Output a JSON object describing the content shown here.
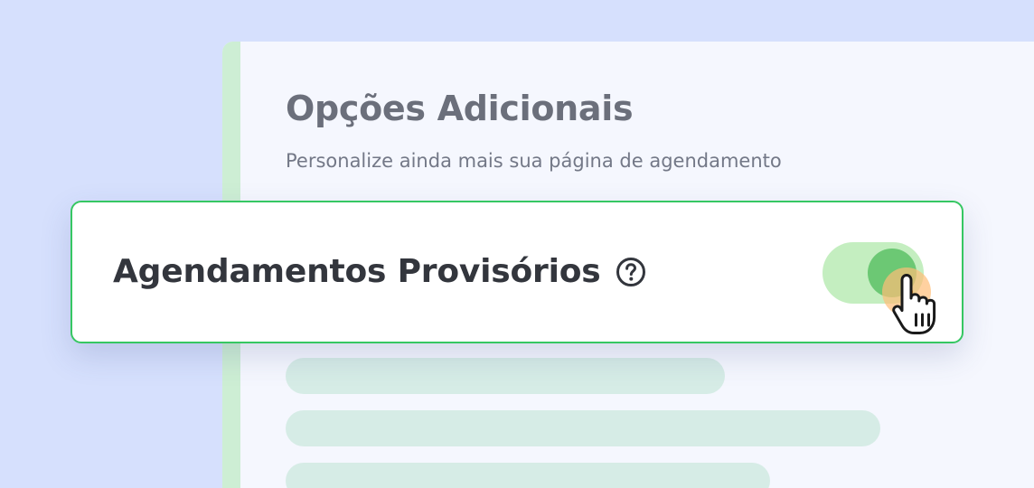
{
  "panel": {
    "title": "Opções Adicionais",
    "subtitle": "Personalize ainda mais sua página de agendamento"
  },
  "card": {
    "title": "Agendamentos Provisórios",
    "help_icon": "help-circle-icon",
    "toggle_state": "on",
    "cursor_icon": "hand-pointer-icon"
  },
  "colors": {
    "background": "#d6e0fd",
    "panel": "#f5f7fe",
    "accent_green": "#36c762",
    "toggle_track": "#c4eec0",
    "toggle_knob": "#6cc874",
    "placeholder": "#d6ece6",
    "click_highlight": "#ee8a1c"
  }
}
